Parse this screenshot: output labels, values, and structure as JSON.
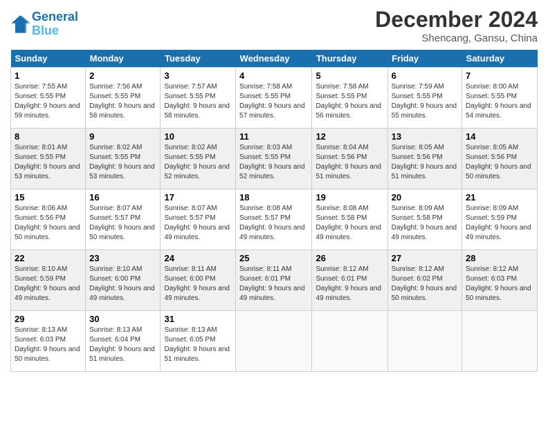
{
  "header": {
    "logo_line1": "General",
    "logo_line2": "Blue",
    "month_year": "December 2024",
    "location": "Shencang, Gansu, China"
  },
  "weekdays": [
    "Sunday",
    "Monday",
    "Tuesday",
    "Wednesday",
    "Thursday",
    "Friday",
    "Saturday"
  ],
  "weeks": [
    [
      {
        "day": "1",
        "sunrise": "Sunrise: 7:55 AM",
        "sunset": "Sunset: 5:55 PM",
        "daylight": "Daylight: 9 hours and 59 minutes."
      },
      {
        "day": "2",
        "sunrise": "Sunrise: 7:56 AM",
        "sunset": "Sunset: 5:55 PM",
        "daylight": "Daylight: 9 hours and 58 minutes."
      },
      {
        "day": "3",
        "sunrise": "Sunrise: 7:57 AM",
        "sunset": "Sunset: 5:55 PM",
        "daylight": "Daylight: 9 hours and 58 minutes."
      },
      {
        "day": "4",
        "sunrise": "Sunrise: 7:58 AM",
        "sunset": "Sunset: 5:55 PM",
        "daylight": "Daylight: 9 hours and 57 minutes."
      },
      {
        "day": "5",
        "sunrise": "Sunrise: 7:58 AM",
        "sunset": "Sunset: 5:55 PM",
        "daylight": "Daylight: 9 hours and 56 minutes."
      },
      {
        "day": "6",
        "sunrise": "Sunrise: 7:59 AM",
        "sunset": "Sunset: 5:55 PM",
        "daylight": "Daylight: 9 hours and 55 minutes."
      },
      {
        "day": "7",
        "sunrise": "Sunrise: 8:00 AM",
        "sunset": "Sunset: 5:55 PM",
        "daylight": "Daylight: 9 hours and 54 minutes."
      }
    ],
    [
      {
        "day": "8",
        "sunrise": "Sunrise: 8:01 AM",
        "sunset": "Sunset: 5:55 PM",
        "daylight": "Daylight: 9 hours and 53 minutes."
      },
      {
        "day": "9",
        "sunrise": "Sunrise: 8:02 AM",
        "sunset": "Sunset: 5:55 PM",
        "daylight": "Daylight: 9 hours and 53 minutes."
      },
      {
        "day": "10",
        "sunrise": "Sunrise: 8:02 AM",
        "sunset": "Sunset: 5:55 PM",
        "daylight": "Daylight: 9 hours and 52 minutes."
      },
      {
        "day": "11",
        "sunrise": "Sunrise: 8:03 AM",
        "sunset": "Sunset: 5:55 PM",
        "daylight": "Daylight: 9 hours and 52 minutes."
      },
      {
        "day": "12",
        "sunrise": "Sunrise: 8:04 AM",
        "sunset": "Sunset: 5:56 PM",
        "daylight": "Daylight: 9 hours and 51 minutes."
      },
      {
        "day": "13",
        "sunrise": "Sunrise: 8:05 AM",
        "sunset": "Sunset: 5:56 PM",
        "daylight": "Daylight: 9 hours and 51 minutes."
      },
      {
        "day": "14",
        "sunrise": "Sunrise: 8:05 AM",
        "sunset": "Sunset: 5:56 PM",
        "daylight": "Daylight: 9 hours and 50 minutes."
      }
    ],
    [
      {
        "day": "15",
        "sunrise": "Sunrise: 8:06 AM",
        "sunset": "Sunset: 5:56 PM",
        "daylight": "Daylight: 9 hours and 50 minutes."
      },
      {
        "day": "16",
        "sunrise": "Sunrise: 8:07 AM",
        "sunset": "Sunset: 5:57 PM",
        "daylight": "Daylight: 9 hours and 50 minutes."
      },
      {
        "day": "17",
        "sunrise": "Sunrise: 8:07 AM",
        "sunset": "Sunset: 5:57 PM",
        "daylight": "Daylight: 9 hours and 49 minutes."
      },
      {
        "day": "18",
        "sunrise": "Sunrise: 8:08 AM",
        "sunset": "Sunset: 5:57 PM",
        "daylight": "Daylight: 9 hours and 49 minutes."
      },
      {
        "day": "19",
        "sunrise": "Sunrise: 8:08 AM",
        "sunset": "Sunset: 5:58 PM",
        "daylight": "Daylight: 9 hours and 49 minutes."
      },
      {
        "day": "20",
        "sunrise": "Sunrise: 8:09 AM",
        "sunset": "Sunset: 5:58 PM",
        "daylight": "Daylight: 9 hours and 49 minutes."
      },
      {
        "day": "21",
        "sunrise": "Sunrise: 8:09 AM",
        "sunset": "Sunset: 5:59 PM",
        "daylight": "Daylight: 9 hours and 49 minutes."
      }
    ],
    [
      {
        "day": "22",
        "sunrise": "Sunrise: 8:10 AM",
        "sunset": "Sunset: 5:59 PM",
        "daylight": "Daylight: 9 hours and 49 minutes."
      },
      {
        "day": "23",
        "sunrise": "Sunrise: 8:10 AM",
        "sunset": "Sunset: 6:00 PM",
        "daylight": "Daylight: 9 hours and 49 minutes."
      },
      {
        "day": "24",
        "sunrise": "Sunrise: 8:11 AM",
        "sunset": "Sunset: 6:00 PM",
        "daylight": "Daylight: 9 hours and 49 minutes."
      },
      {
        "day": "25",
        "sunrise": "Sunrise: 8:11 AM",
        "sunset": "Sunset: 6:01 PM",
        "daylight": "Daylight: 9 hours and 49 minutes."
      },
      {
        "day": "26",
        "sunrise": "Sunrise: 8:12 AM",
        "sunset": "Sunset: 6:01 PM",
        "daylight": "Daylight: 9 hours and 49 minutes."
      },
      {
        "day": "27",
        "sunrise": "Sunrise: 8:12 AM",
        "sunset": "Sunset: 6:02 PM",
        "daylight": "Daylight: 9 hours and 50 minutes."
      },
      {
        "day": "28",
        "sunrise": "Sunrise: 8:12 AM",
        "sunset": "Sunset: 6:03 PM",
        "daylight": "Daylight: 9 hours and 50 minutes."
      }
    ],
    [
      {
        "day": "29",
        "sunrise": "Sunrise: 8:13 AM",
        "sunset": "Sunset: 6:03 PM",
        "daylight": "Daylight: 9 hours and 50 minutes."
      },
      {
        "day": "30",
        "sunrise": "Sunrise: 8:13 AM",
        "sunset": "Sunset: 6:04 PM",
        "daylight": "Daylight: 9 hours and 51 minutes."
      },
      {
        "day": "31",
        "sunrise": "Sunrise: 8:13 AM",
        "sunset": "Sunset: 6:05 PM",
        "daylight": "Daylight: 9 hours and 51 minutes."
      },
      null,
      null,
      null,
      null
    ]
  ]
}
